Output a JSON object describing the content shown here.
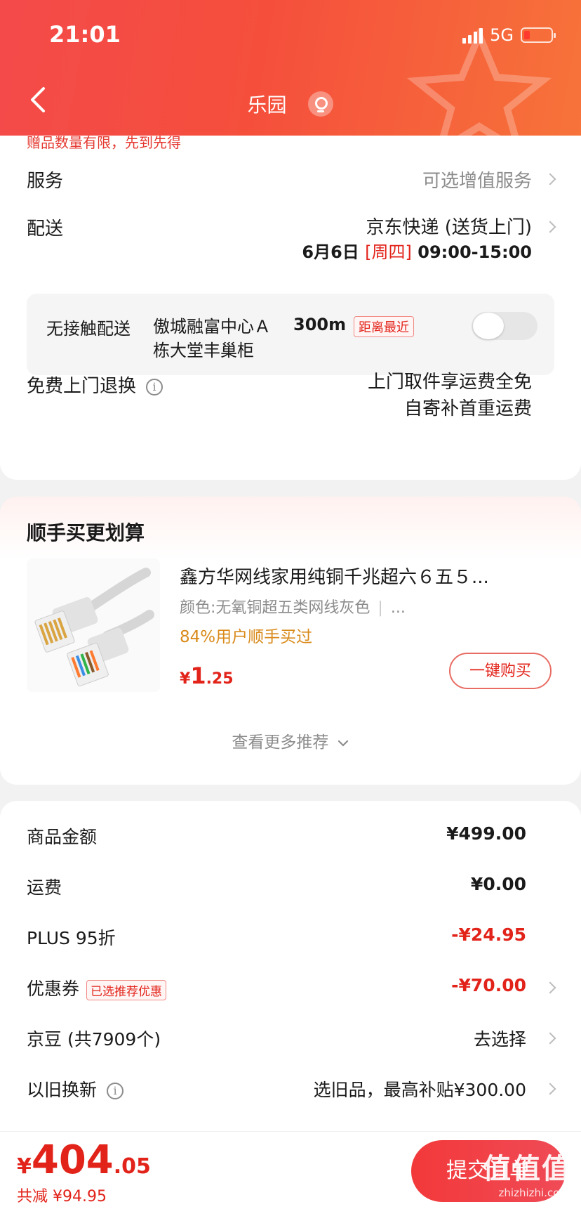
{
  "status_bar": {
    "time": "21:01",
    "network": "5G"
  },
  "header": {
    "title": "乐园"
  },
  "gift_note": "赠品数量有限，先到先得",
  "service": {
    "label": "服务",
    "value": "可选增值服务"
  },
  "delivery": {
    "label": "配送",
    "carrier": "京东快递 (送货上门)",
    "date": "6月6日",
    "weekday": "[周四]",
    "time": "09:00-15:00"
  },
  "contactless": {
    "label": "无接触配送",
    "address": "傲城融富中心Ａ栋大堂丰巢柜",
    "distance": "300m",
    "tag": "距离最近",
    "enabled": false
  },
  "return_policy": {
    "label": "免费上门退换",
    "line1": "上门取件享运费全免",
    "line2": "自寄补首重运费"
  },
  "recommend": {
    "title": "顺手买更划算",
    "product": {
      "name": "鑫方华网线家用纯铜千兆超六６五５...",
      "spec": "颜色:无氧铜超五类网线灰色",
      "spec_more": "...",
      "stat": "84%用户顺手买过",
      "price_symbol": "¥",
      "price_int": "1",
      "price_dec": ".25",
      "buy_label": "一键购买"
    },
    "more_label": "查看更多推荐"
  },
  "fees": {
    "goods": {
      "label": "商品金额",
      "value": "¥499.00"
    },
    "shipping": {
      "label": "运费",
      "value": "¥0.00"
    },
    "plus": {
      "label": "PLUS 95折",
      "value": "-¥24.95"
    },
    "coupon": {
      "label": "优惠券",
      "tag": "已选推荐优惠",
      "value": "-¥70.00"
    },
    "beans": {
      "label": "京豆 (共7909个)",
      "value": "去选择"
    },
    "trade_in": {
      "label": "以旧换新",
      "value": "选旧品，最高补贴¥300.00"
    }
  },
  "bottom": {
    "total_symbol": "¥",
    "total_int": "404",
    "total_dec": ".05",
    "saved": "共减 ¥94.95",
    "submit_label": "提交订单",
    "watermark": "值值值",
    "watermark_sub": "zhizhizhi.com"
  },
  "colors": {
    "brand_red": "#e2231a",
    "header_start": "#f44a4a",
    "header_end": "#f7733a"
  }
}
